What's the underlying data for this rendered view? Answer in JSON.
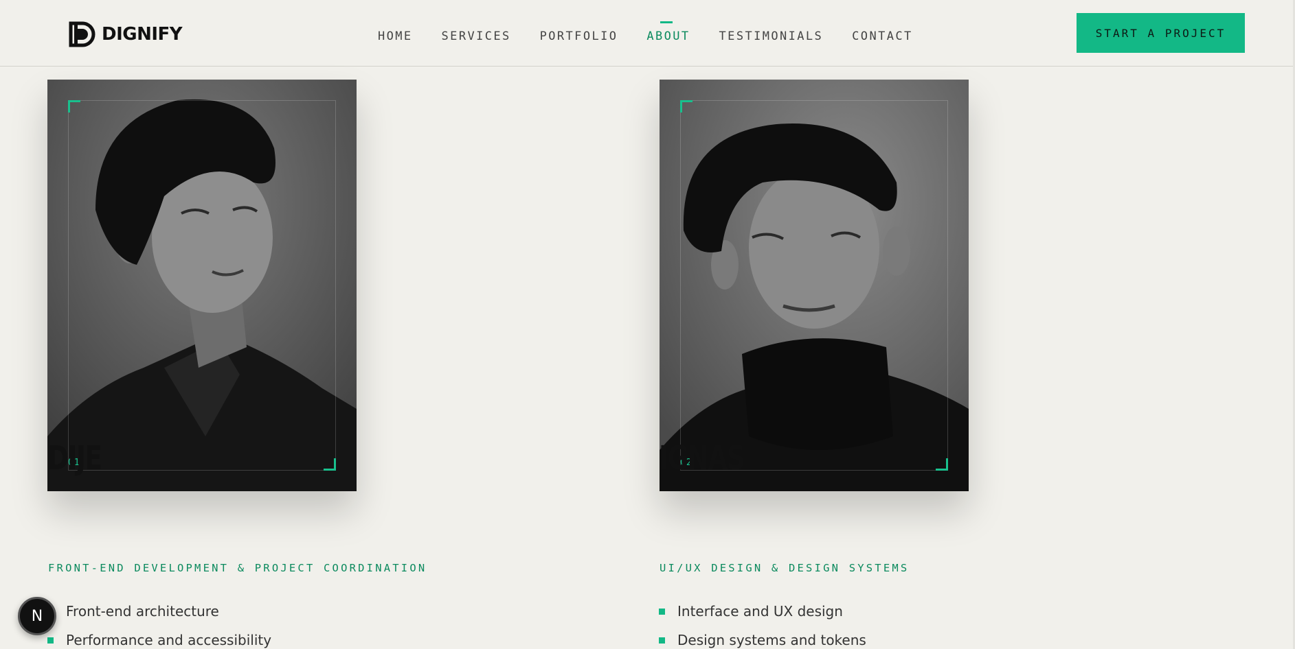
{
  "brand": {
    "name": "DIGNIFY",
    "icon": "dd-logo-mark"
  },
  "nav": {
    "items": [
      {
        "label": "HOME",
        "active": false
      },
      {
        "label": "SERVICES",
        "active": false
      },
      {
        "label": "PORTFOLIO",
        "active": false
      },
      {
        "label": "ABOUT",
        "active": true
      },
      {
        "label": "TESTIMONIALS",
        "active": false
      },
      {
        "label": "CONTACT",
        "active": false
      }
    ],
    "cta_label": "START A PROJECT"
  },
  "team": [
    {
      "index": "01",
      "name": "DIJE",
      "role": "FRONT-END DEVELOPMENT & PROJECT COORDINATION",
      "skills": [
        "Front-end architecture",
        "Performance and accessibility"
      ]
    },
    {
      "index": "02",
      "name": "IGNAS",
      "role": "UI/UX DESIGN & DESIGN SYSTEMS",
      "skills": [
        "Interface and UX design",
        "Design systems and tokens"
      ]
    }
  ],
  "badge": {
    "label": "N"
  },
  "colors": {
    "accent": "#13b886",
    "accent_text": "#0c8a5e",
    "background": "#f1f0eb"
  }
}
